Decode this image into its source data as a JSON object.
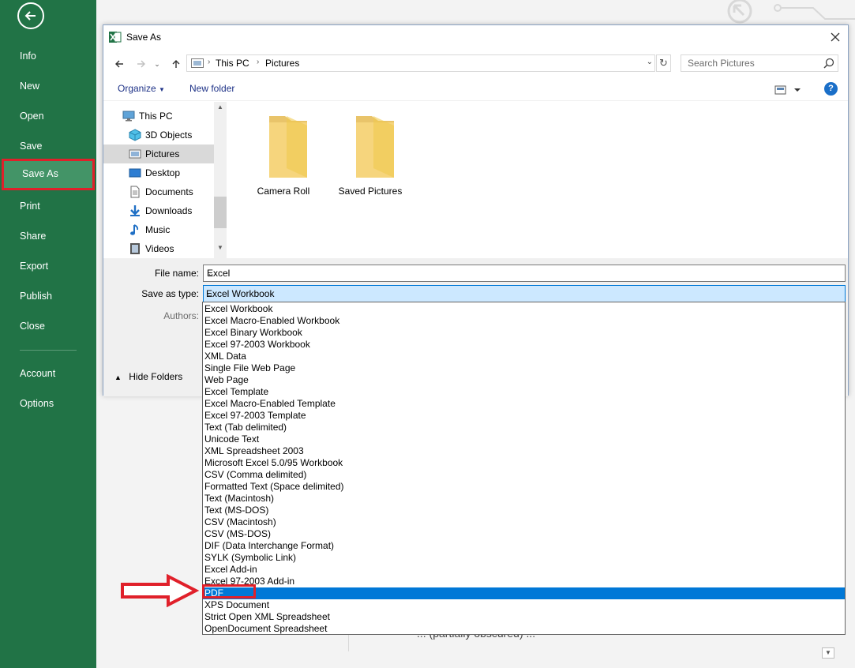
{
  "sidebar": {
    "items": [
      {
        "label": "Info"
      },
      {
        "label": "New"
      },
      {
        "label": "Open"
      },
      {
        "label": "Save"
      },
      {
        "label": "Save As"
      },
      {
        "label": "Print"
      },
      {
        "label": "Share"
      },
      {
        "label": "Export"
      },
      {
        "label": "Publish"
      },
      {
        "label": "Close"
      },
      {
        "label": "Account"
      },
      {
        "label": "Options"
      }
    ],
    "selected_label": "Save As",
    "accent": "#217346",
    "highlight_border": "#e0202a"
  },
  "background": {
    "partial_text": "... (partially obscured) ..."
  },
  "dialog": {
    "title": "Save As",
    "address": {
      "crumbs": [
        "This PC",
        "Pictures"
      ]
    },
    "search_placeholder": "Search Pictures",
    "toolbar": {
      "organize_label": "Organize",
      "new_folder_label": "New folder"
    },
    "nav_tree": [
      {
        "label": "This PC",
        "icon": "computer-icon"
      },
      {
        "label": "3D Objects",
        "icon": "cube-icon"
      },
      {
        "label": "Pictures",
        "icon": "pictures-icon",
        "selected": true
      },
      {
        "label": "Desktop",
        "icon": "desktop-icon"
      },
      {
        "label": "Documents",
        "icon": "documents-icon"
      },
      {
        "label": "Downloads",
        "icon": "download-icon"
      },
      {
        "label": "Music",
        "icon": "music-icon"
      },
      {
        "label": "Videos",
        "icon": "video-icon"
      }
    ],
    "folders": [
      {
        "label": "Camera Roll"
      },
      {
        "label": "Saved Pictures"
      }
    ],
    "form": {
      "file_name_label": "File name:",
      "file_name_value": "Excel",
      "save_type_label": "Save as type:",
      "save_type_value": "Excel Workbook",
      "authors_label": "Authors:"
    },
    "hide_folders_label": "Hide Folders"
  },
  "file_types": [
    "Excel Workbook",
    "Excel Macro-Enabled Workbook",
    "Excel Binary Workbook",
    "Excel 97-2003 Workbook",
    "XML Data",
    "Single File Web Page",
    "Web Page",
    "Excel Template",
    "Excel Macro-Enabled Template",
    "Excel 97-2003 Template",
    "Text (Tab delimited)",
    "Unicode Text",
    "XML Spreadsheet 2003",
    "Microsoft Excel 5.0/95 Workbook",
    "CSV (Comma delimited)",
    "Formatted Text (Space delimited)",
    "Text (Macintosh)",
    "Text (MS-DOS)",
    "CSV (Macintosh)",
    "CSV (MS-DOS)",
    "DIF (Data Interchange Format)",
    "SYLK (Symbolic Link)",
    "Excel Add-in",
    "Excel 97-2003 Add-in",
    "PDF",
    "XPS Document",
    "Strict Open XML Spreadsheet",
    "OpenDocument Spreadsheet"
  ],
  "highlighted_type": "PDF",
  "highlight_color": "#0078d7"
}
